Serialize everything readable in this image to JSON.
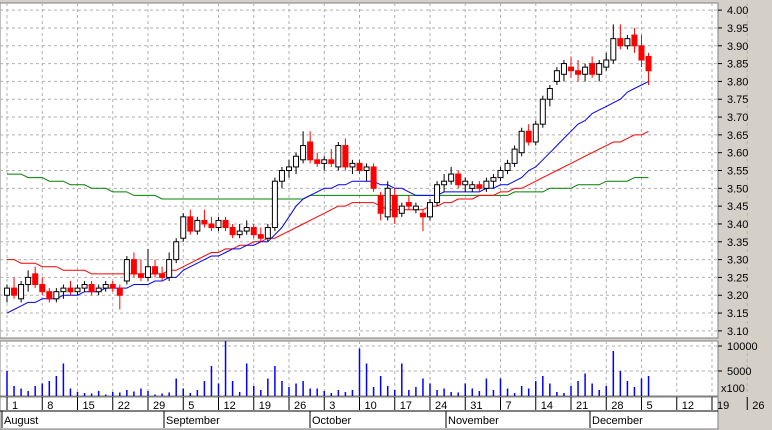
{
  "chart_data": [
    {
      "type": "candlestick",
      "title": "",
      "ylim": [
        3.08,
        4.02
      ],
      "y_ticks": [
        "4.00",
        "3.95",
        "3.90",
        "3.85",
        "3.80",
        "3.75",
        "3.70",
        "3.65",
        "3.60",
        "3.55",
        "3.50",
        "3.45",
        "3.40",
        "3.35",
        "3.30",
        "3.25",
        "3.20",
        "3.15",
        "3.10"
      ],
      "x_day_ticks": [
        "1",
        "8",
        "15",
        "22",
        "29",
        "5",
        "12",
        "19",
        "26",
        "3",
        "10",
        "17",
        "24",
        "31",
        "7",
        "14",
        "21",
        "28",
        "5",
        "12",
        "19",
        "26"
      ],
      "x_month_labels": [
        "August",
        "September",
        "October",
        "November",
        "December"
      ],
      "grid": true,
      "colors": {
        "up": "#000000",
        "down": "#ff0000",
        "ma_short": "#0000ff",
        "ma_mid": "#ff0000",
        "ma_long": "#008000"
      },
      "candles": [
        [
          3.2,
          3.23,
          3.18,
          3.22
        ],
        [
          3.22,
          3.25,
          3.19,
          3.2
        ],
        [
          3.19,
          3.24,
          3.18,
          3.23
        ],
        [
          3.23,
          3.27,
          3.21,
          3.25
        ],
        [
          3.26,
          3.28,
          3.22,
          3.23
        ],
        [
          3.23,
          3.25,
          3.2,
          3.21
        ],
        [
          3.21,
          3.22,
          3.18,
          3.19
        ],
        [
          3.19,
          3.22,
          3.18,
          3.21
        ],
        [
          3.21,
          3.23,
          3.19,
          3.22
        ],
        [
          3.22,
          3.24,
          3.2,
          3.21
        ],
        [
          3.21,
          3.23,
          3.2,
          3.22
        ],
        [
          3.22,
          3.24,
          3.21,
          3.23
        ],
        [
          3.23,
          3.24,
          3.2,
          3.21
        ],
        [
          3.21,
          3.23,
          3.2,
          3.22
        ],
        [
          3.22,
          3.24,
          3.21,
          3.23
        ],
        [
          3.23,
          3.24,
          3.21,
          3.22
        ],
        [
          3.22,
          3.23,
          3.16,
          3.2
        ],
        [
          3.24,
          3.31,
          3.23,
          3.3
        ],
        [
          3.3,
          3.32,
          3.25,
          3.26
        ],
        [
          3.26,
          3.3,
          3.24,
          3.25
        ],
        [
          3.25,
          3.33,
          3.24,
          3.28
        ],
        [
          3.28,
          3.3,
          3.25,
          3.26
        ],
        [
          3.26,
          3.28,
          3.24,
          3.25
        ],
        [
          3.25,
          3.32,
          3.24,
          3.3
        ],
        [
          3.3,
          3.36,
          3.29,
          3.35
        ],
        [
          3.36,
          3.43,
          3.35,
          3.42
        ],
        [
          3.42,
          3.44,
          3.37,
          3.38
        ],
        [
          3.38,
          3.42,
          3.37,
          3.41
        ],
        [
          3.41,
          3.44,
          3.39,
          3.4
        ],
        [
          3.4,
          3.42,
          3.38,
          3.39
        ],
        [
          3.39,
          3.42,
          3.38,
          3.41
        ],
        [
          3.41,
          3.42,
          3.38,
          3.39
        ],
        [
          3.39,
          3.4,
          3.36,
          3.37
        ],
        [
          3.37,
          3.4,
          3.36,
          3.38
        ],
        [
          3.38,
          3.41,
          3.37,
          3.39
        ],
        [
          3.39,
          3.4,
          3.36,
          3.37
        ],
        [
          3.37,
          3.39,
          3.35,
          3.36
        ],
        [
          3.36,
          3.4,
          3.35,
          3.39
        ],
        [
          3.39,
          3.53,
          3.38,
          3.52
        ],
        [
          3.52,
          3.56,
          3.5,
          3.55
        ],
        [
          3.55,
          3.58,
          3.53,
          3.56
        ],
        [
          3.56,
          3.6,
          3.54,
          3.59
        ],
        [
          3.58,
          3.66,
          3.57,
          3.62
        ],
        [
          3.63,
          3.66,
          3.57,
          3.58
        ],
        [
          3.58,
          3.6,
          3.56,
          3.57
        ],
        [
          3.57,
          3.59,
          3.55,
          3.58
        ],
        [
          3.58,
          3.61,
          3.56,
          3.57
        ],
        [
          3.56,
          3.63,
          3.55,
          3.62
        ],
        [
          3.62,
          3.64,
          3.55,
          3.56
        ],
        [
          3.56,
          3.58,
          3.54,
          3.57
        ],
        [
          3.57,
          3.58,
          3.54,
          3.55
        ],
        [
          3.55,
          3.57,
          3.52,
          3.56
        ],
        [
          3.56,
          3.57,
          3.49,
          3.5
        ],
        [
          3.48,
          3.49,
          3.41,
          3.43
        ],
        [
          3.42,
          3.52,
          3.41,
          3.5
        ],
        [
          3.48,
          3.5,
          3.4,
          3.42
        ],
        [
          3.43,
          3.46,
          3.42,
          3.45
        ],
        [
          3.46,
          3.48,
          3.44,
          3.45
        ],
        [
          3.44,
          3.46,
          3.43,
          3.45
        ],
        [
          3.43,
          3.44,
          3.38,
          3.42
        ],
        [
          3.42,
          3.47,
          3.41,
          3.46
        ],
        [
          3.46,
          3.52,
          3.45,
          3.51
        ],
        [
          3.51,
          3.54,
          3.49,
          3.52
        ],
        [
          3.52,
          3.56,
          3.51,
          3.54
        ],
        [
          3.54,
          3.55,
          3.5,
          3.51
        ],
        [
          3.51,
          3.53,
          3.49,
          3.52
        ],
        [
          3.5,
          3.52,
          3.49,
          3.51
        ],
        [
          3.51,
          3.52,
          3.49,
          3.5
        ],
        [
          3.5,
          3.53,
          3.49,
          3.52
        ],
        [
          3.52,
          3.54,
          3.5,
          3.53
        ],
        [
          3.53,
          3.56,
          3.52,
          3.55
        ],
        [
          3.55,
          3.58,
          3.54,
          3.57
        ],
        [
          3.57,
          3.62,
          3.56,
          3.61
        ],
        [
          3.6,
          3.67,
          3.59,
          3.66
        ],
        [
          3.66,
          3.68,
          3.62,
          3.63
        ],
        [
          3.63,
          3.69,
          3.62,
          3.68
        ],
        [
          3.68,
          3.76,
          3.67,
          3.75
        ],
        [
          3.75,
          3.79,
          3.73,
          3.78
        ],
        [
          3.8,
          3.84,
          3.79,
          3.83
        ],
        [
          3.82,
          3.86,
          3.8,
          3.85
        ],
        [
          3.84,
          3.87,
          3.81,
          3.83
        ],
        [
          3.83,
          3.86,
          3.8,
          3.82
        ],
        [
          3.82,
          3.85,
          3.8,
          3.84
        ],
        [
          3.85,
          3.87,
          3.81,
          3.82
        ],
        [
          3.82,
          3.86,
          3.8,
          3.85
        ],
        [
          3.84,
          3.88,
          3.83,
          3.86
        ],
        [
          3.86,
          3.96,
          3.85,
          3.92
        ],
        [
          3.92,
          3.96,
          3.89,
          3.9
        ],
        [
          3.9,
          3.93,
          3.89,
          3.92
        ],
        [
          3.93,
          3.95,
          3.88,
          3.9
        ],
        [
          3.9,
          3.93,
          3.84,
          3.86
        ],
        [
          3.87,
          3.88,
          3.79,
          3.83
        ]
      ],
      "ma_short": [
        3.15,
        3.16,
        3.17,
        3.18,
        3.18,
        3.19,
        3.19,
        3.19,
        3.2,
        3.2,
        3.2,
        3.21,
        3.21,
        3.21,
        3.22,
        3.22,
        3.22,
        3.22,
        3.23,
        3.23,
        3.23,
        3.24,
        3.24,
        3.25,
        3.25,
        3.27,
        3.28,
        3.29,
        3.3,
        3.31,
        3.31,
        3.32,
        3.33,
        3.33,
        3.34,
        3.34,
        3.35,
        3.35,
        3.37,
        3.39,
        3.42,
        3.45,
        3.47,
        3.48,
        3.49,
        3.5,
        3.5,
        3.51,
        3.51,
        3.52,
        3.52,
        3.52,
        3.52,
        3.51,
        3.51,
        3.5,
        3.5,
        3.49,
        3.48,
        3.48,
        3.48,
        3.48,
        3.49,
        3.49,
        3.49,
        3.49,
        3.49,
        3.49,
        3.5,
        3.5,
        3.51,
        3.51,
        3.52,
        3.53,
        3.55,
        3.56,
        3.58,
        3.6,
        3.62,
        3.64,
        3.66,
        3.68,
        3.69,
        3.71,
        3.72,
        3.73,
        3.74,
        3.75,
        3.77,
        3.78,
        3.79,
        3.8
      ],
      "ma_mid": [
        3.3,
        3.3,
        3.29,
        3.29,
        3.29,
        3.28,
        3.28,
        3.28,
        3.27,
        3.27,
        3.27,
        3.27,
        3.26,
        3.26,
        3.26,
        3.26,
        3.26,
        3.26,
        3.26,
        3.26,
        3.26,
        3.26,
        3.26,
        3.27,
        3.27,
        3.28,
        3.29,
        3.3,
        3.31,
        3.32,
        3.32,
        3.33,
        3.33,
        3.34,
        3.34,
        3.35,
        3.35,
        3.36,
        3.36,
        3.37,
        3.38,
        3.39,
        3.4,
        3.41,
        3.42,
        3.43,
        3.44,
        3.45,
        3.45,
        3.46,
        3.46,
        3.46,
        3.46,
        3.45,
        3.44,
        3.44,
        3.44,
        3.44,
        3.44,
        3.44,
        3.45,
        3.45,
        3.46,
        3.46,
        3.47,
        3.47,
        3.47,
        3.48,
        3.48,
        3.48,
        3.49,
        3.49,
        3.5,
        3.5,
        3.51,
        3.52,
        3.53,
        3.54,
        3.55,
        3.56,
        3.57,
        3.58,
        3.59,
        3.6,
        3.61,
        3.62,
        3.63,
        3.63,
        3.64,
        3.65,
        3.65,
        3.66
      ],
      "ma_long": [
        3.54,
        3.54,
        3.54,
        3.53,
        3.53,
        3.53,
        3.52,
        3.52,
        3.52,
        3.51,
        3.51,
        3.51,
        3.5,
        3.5,
        3.5,
        3.49,
        3.49,
        3.49,
        3.48,
        3.48,
        3.48,
        3.48,
        3.47,
        3.47,
        3.47,
        3.47,
        3.47,
        3.47,
        3.47,
        3.47,
        3.47,
        3.47,
        3.47,
        3.47,
        3.47,
        3.47,
        3.47,
        3.47,
        3.47,
        3.47,
        3.47,
        3.47,
        3.47,
        3.48,
        3.48,
        3.48,
        3.48,
        3.48,
        3.48,
        3.48,
        3.48,
        3.48,
        3.48,
        3.48,
        3.48,
        3.48,
        3.48,
        3.48,
        3.48,
        3.48,
        3.48,
        3.48,
        3.48,
        3.48,
        3.48,
        3.48,
        3.48,
        3.48,
        3.48,
        3.48,
        3.48,
        3.48,
        3.49,
        3.49,
        3.49,
        3.49,
        3.49,
        3.5,
        3.5,
        3.5,
        3.5,
        3.51,
        3.51,
        3.51,
        3.51,
        3.52,
        3.52,
        3.52,
        3.52,
        3.53,
        3.53,
        3.53
      ]
    },
    {
      "type": "bar",
      "title": "",
      "ylim": [
        0,
        11000
      ],
      "y_ticks": [
        "10000",
        "5000"
      ],
      "unit_label": "x100",
      "values": [
        5000,
        2000,
        1500,
        1000,
        2000,
        2500,
        3000,
        4000,
        6500,
        1500,
        800,
        600,
        500,
        1000,
        300,
        800,
        700,
        1200,
        900,
        1500,
        1000,
        300,
        500,
        700,
        3500,
        1500,
        600,
        1200,
        3000,
        6000,
        2500,
        11000,
        3000,
        800,
        6500,
        2000,
        1200,
        3500,
        6000,
        3000,
        1800,
        2500,
        3000,
        1500,
        1500,
        1000,
        600,
        1200,
        800,
        1200,
        9500,
        6500,
        1800,
        4000,
        2000,
        1200,
        6500,
        1200,
        1800,
        3500,
        2500,
        1200,
        1500,
        800,
        700,
        2500,
        1500,
        1000,
        3500,
        1200,
        3500,
        1500,
        600,
        2000,
        1500,
        3000,
        4000,
        2500,
        800,
        600,
        2000,
        3000,
        4500,
        2500,
        1200,
        2000,
        9000,
        5000,
        3000,
        1800,
        3500,
        4000
      ]
    }
  ]
}
